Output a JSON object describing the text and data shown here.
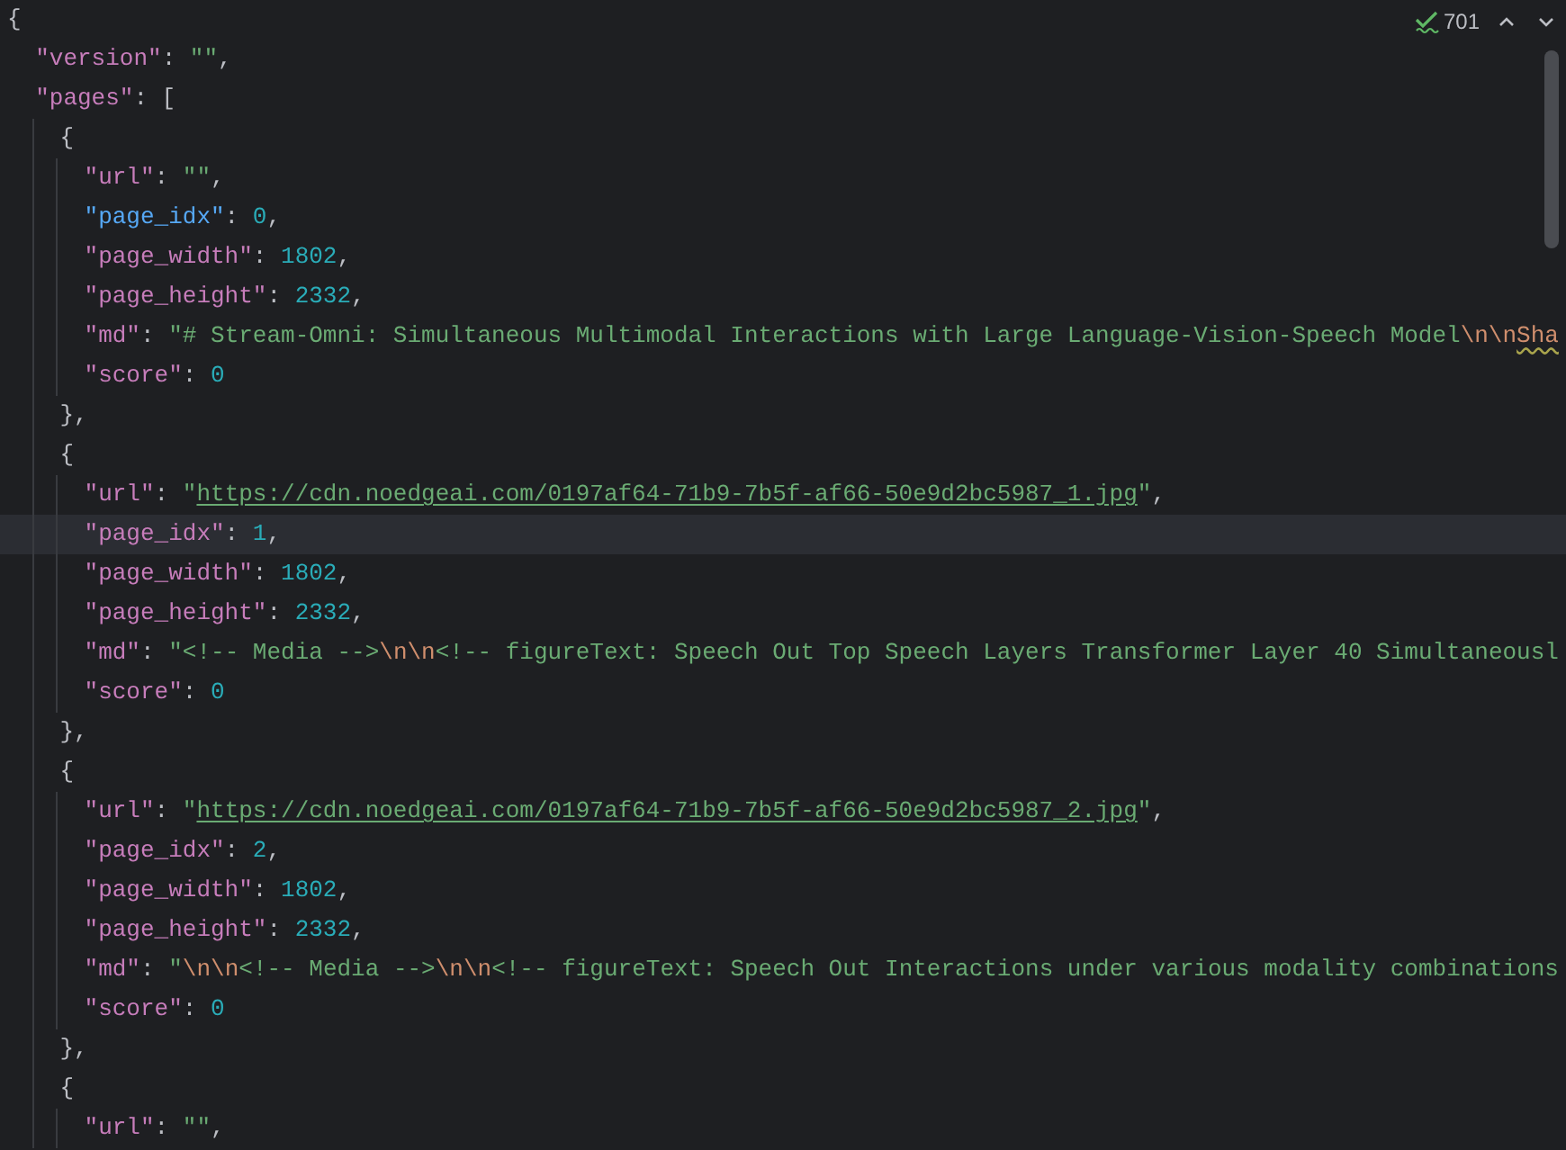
{
  "editor": {
    "inspection": {
      "count": "701"
    },
    "lines": [
      {
        "current": false,
        "tokens": [
          {
            "kind": "punct",
            "text": "{"
          }
        ],
        "children": [
          {
            "current": false,
            "tokens": [
              {
                "kind": "key",
                "text": "\"version\""
              },
              {
                "kind": "punct",
                "text": ": "
              },
              {
                "kind": "string",
                "text": "\"\""
              },
              {
                "kind": "punct",
                "text": ","
              }
            ]
          },
          {
            "current": false,
            "tokens": [
              {
                "kind": "key",
                "text": "\"pages\""
              },
              {
                "kind": "punct",
                "text": ": ["
              }
            ],
            "children": [
              {
                "current": false,
                "tokens": [
                  {
                    "kind": "punct",
                    "text": "{"
                  }
                ],
                "children": [
                  {
                    "current": false,
                    "tokens": [
                      {
                        "kind": "key",
                        "text": "\"url\""
                      },
                      {
                        "kind": "punct",
                        "text": ": "
                      },
                      {
                        "kind": "string",
                        "text": "\"\""
                      },
                      {
                        "kind": "punct",
                        "text": ","
                      }
                    ]
                  },
                  {
                    "current": false,
                    "tokens": [
                      {
                        "kind": "key_alt",
                        "text": "\"page_idx\""
                      },
                      {
                        "kind": "punct",
                        "text": ": "
                      },
                      {
                        "kind": "number",
                        "text": "0"
                      },
                      {
                        "kind": "punct",
                        "text": ","
                      }
                    ]
                  },
                  {
                    "current": false,
                    "tokens": [
                      {
                        "kind": "key",
                        "text": "\"page_width\""
                      },
                      {
                        "kind": "punct",
                        "text": ": "
                      },
                      {
                        "kind": "number",
                        "text": "1802"
                      },
                      {
                        "kind": "punct",
                        "text": ","
                      }
                    ]
                  },
                  {
                    "current": false,
                    "tokens": [
                      {
                        "kind": "key",
                        "text": "\"page_height\""
                      },
                      {
                        "kind": "punct",
                        "text": ": "
                      },
                      {
                        "kind": "number",
                        "text": "2332"
                      },
                      {
                        "kind": "punct",
                        "text": ","
                      }
                    ]
                  },
                  {
                    "current": false,
                    "tokens": [
                      {
                        "kind": "key",
                        "text": "\"md\""
                      },
                      {
                        "kind": "punct",
                        "text": ": "
                      },
                      {
                        "kind": "string",
                        "text": "\"# Stream-Omni: Simultaneous Multimodal Interactions with Large Language-Vision-Speech Model"
                      },
                      {
                        "kind": "escape",
                        "text": "\\n\\n"
                      },
                      {
                        "kind": "typo",
                        "text": "Sha"
                      }
                    ]
                  },
                  {
                    "current": false,
                    "tokens": [
                      {
                        "kind": "key",
                        "text": "\"score\""
                      },
                      {
                        "kind": "punct",
                        "text": ": "
                      },
                      {
                        "kind": "number",
                        "text": "0"
                      }
                    ]
                  }
                ]
              },
              {
                "current": false,
                "tokens": [
                  {
                    "kind": "punct",
                    "text": "},"
                  }
                ]
              },
              {
                "current": false,
                "tokens": [
                  {
                    "kind": "punct",
                    "text": "{"
                  }
                ],
                "children": [
                  {
                    "current": false,
                    "tokens": [
                      {
                        "kind": "key",
                        "text": "\"url\""
                      },
                      {
                        "kind": "punct",
                        "text": ": "
                      },
                      {
                        "kind": "string",
                        "text": "\""
                      },
                      {
                        "kind": "link",
                        "text": "https://cdn.noedgeai.com/0197af64-71b9-7b5f-af66-50e9d2bc5987_1.jpg"
                      },
                      {
                        "kind": "string",
                        "text": "\""
                      },
                      {
                        "kind": "punct",
                        "text": ","
                      }
                    ]
                  },
                  {
                    "current": true,
                    "tokens": [
                      {
                        "kind": "key",
                        "text": "\"page_idx\""
                      },
                      {
                        "kind": "punct",
                        "text": ": "
                      },
                      {
                        "kind": "number",
                        "text": "1"
                      },
                      {
                        "kind": "punct",
                        "text": ","
                      }
                    ]
                  },
                  {
                    "current": false,
                    "tokens": [
                      {
                        "kind": "key",
                        "text": "\"page_width\""
                      },
                      {
                        "kind": "punct",
                        "text": ": "
                      },
                      {
                        "kind": "number",
                        "text": "1802"
                      },
                      {
                        "kind": "punct",
                        "text": ","
                      }
                    ]
                  },
                  {
                    "current": false,
                    "tokens": [
                      {
                        "kind": "key",
                        "text": "\"page_height\""
                      },
                      {
                        "kind": "punct",
                        "text": ": "
                      },
                      {
                        "kind": "number",
                        "text": "2332"
                      },
                      {
                        "kind": "punct",
                        "text": ","
                      }
                    ]
                  },
                  {
                    "current": false,
                    "tokens": [
                      {
                        "kind": "key",
                        "text": "\"md\""
                      },
                      {
                        "kind": "punct",
                        "text": ": "
                      },
                      {
                        "kind": "string",
                        "text": "\"<!-- Media -->"
                      },
                      {
                        "kind": "escape",
                        "text": "\\n\\n"
                      },
                      {
                        "kind": "string",
                        "text": "<!-- figureText: Speech Out Top Speech Layers Transformer Layer 40 Simultaneousl"
                      }
                    ]
                  },
                  {
                    "current": false,
                    "tokens": [
                      {
                        "kind": "key",
                        "text": "\"score\""
                      },
                      {
                        "kind": "punct",
                        "text": ": "
                      },
                      {
                        "kind": "number",
                        "text": "0"
                      }
                    ]
                  }
                ]
              },
              {
                "current": false,
                "tokens": [
                  {
                    "kind": "punct",
                    "text": "},"
                  }
                ]
              },
              {
                "current": false,
                "tokens": [
                  {
                    "kind": "punct",
                    "text": "{"
                  }
                ],
                "children": [
                  {
                    "current": false,
                    "tokens": [
                      {
                        "kind": "key",
                        "text": "\"url\""
                      },
                      {
                        "kind": "punct",
                        "text": ": "
                      },
                      {
                        "kind": "string",
                        "text": "\""
                      },
                      {
                        "kind": "link",
                        "text": "https://cdn.noedgeai.com/0197af64-71b9-7b5f-af66-50e9d2bc5987_2.jpg"
                      },
                      {
                        "kind": "string",
                        "text": "\""
                      },
                      {
                        "kind": "punct",
                        "text": ","
                      }
                    ]
                  },
                  {
                    "current": false,
                    "tokens": [
                      {
                        "kind": "key",
                        "text": "\"page_idx\""
                      },
                      {
                        "kind": "punct",
                        "text": ": "
                      },
                      {
                        "kind": "number",
                        "text": "2"
                      },
                      {
                        "kind": "punct",
                        "text": ","
                      }
                    ]
                  },
                  {
                    "current": false,
                    "tokens": [
                      {
                        "kind": "key",
                        "text": "\"page_width\""
                      },
                      {
                        "kind": "punct",
                        "text": ": "
                      },
                      {
                        "kind": "number",
                        "text": "1802"
                      },
                      {
                        "kind": "punct",
                        "text": ","
                      }
                    ]
                  },
                  {
                    "current": false,
                    "tokens": [
                      {
                        "kind": "key",
                        "text": "\"page_height\""
                      },
                      {
                        "kind": "punct",
                        "text": ": "
                      },
                      {
                        "kind": "number",
                        "text": "2332"
                      },
                      {
                        "kind": "punct",
                        "text": ","
                      }
                    ]
                  },
                  {
                    "current": false,
                    "tokens": [
                      {
                        "kind": "key",
                        "text": "\"md\""
                      },
                      {
                        "kind": "punct",
                        "text": ": "
                      },
                      {
                        "kind": "string",
                        "text": "\""
                      },
                      {
                        "kind": "escape",
                        "text": "\\n\\n"
                      },
                      {
                        "kind": "string",
                        "text": "<!-- Media -->"
                      },
                      {
                        "kind": "escape",
                        "text": "\\n\\n"
                      },
                      {
                        "kind": "string",
                        "text": "<!-- figureText: Speech Out Interactions under various modality combinations"
                      }
                    ]
                  },
                  {
                    "current": false,
                    "tokens": [
                      {
                        "kind": "key",
                        "text": "\"score\""
                      },
                      {
                        "kind": "punct",
                        "text": ": "
                      },
                      {
                        "kind": "number",
                        "text": "0"
                      }
                    ]
                  }
                ]
              },
              {
                "current": false,
                "tokens": [
                  {
                    "kind": "punct",
                    "text": "},"
                  }
                ]
              },
              {
                "current": false,
                "tokens": [
                  {
                    "kind": "punct",
                    "text": "{"
                  }
                ],
                "children": [
                  {
                    "current": false,
                    "tokens": [
                      {
                        "kind": "key",
                        "text": "\"url\""
                      },
                      {
                        "kind": "punct",
                        "text": ": "
                      },
                      {
                        "kind": "string",
                        "text": "\"\""
                      },
                      {
                        "kind": "punct",
                        "text": ","
                      }
                    ]
                  }
                ]
              }
            ]
          }
        ]
      }
    ]
  }
}
